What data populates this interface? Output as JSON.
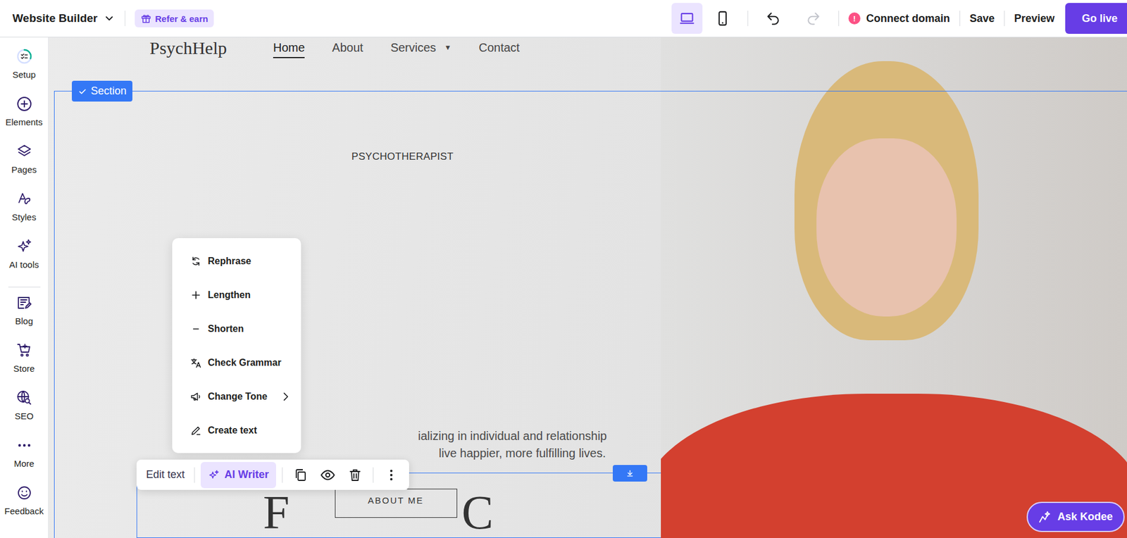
{
  "topbar": {
    "app_menu": "Website Builder",
    "refer": "Refer & earn",
    "devices": [
      {
        "kind": "desktop",
        "selected": true
      },
      {
        "kind": "mobile",
        "selected": false
      }
    ],
    "history": [
      {
        "kind": "undo",
        "disabled": false
      },
      {
        "kind": "redo",
        "disabled": true
      }
    ],
    "domain": {
      "badge": "!",
      "label": "Connect domain"
    },
    "actions": [
      "Save",
      "Preview"
    ],
    "go_live": "Go live"
  },
  "sidebar": {
    "top_items": [
      {
        "label": "Setup",
        "kind": "setup"
      },
      {
        "label": "Elements",
        "kind": "elements"
      },
      {
        "label": "Pages",
        "kind": "pages"
      },
      {
        "label": "Styles",
        "kind": "styles"
      },
      {
        "label": "AI tools",
        "kind": "ai"
      }
    ],
    "bottom_items": [
      {
        "label": "Blog",
        "kind": "blog"
      },
      {
        "label": "Store",
        "kind": "store"
      },
      {
        "label": "SEO",
        "kind": "seo"
      },
      {
        "label": "More",
        "kind": "more"
      },
      {
        "label": "Feedback",
        "kind": "feedback"
      }
    ]
  },
  "site": {
    "logo": "PsychHelp",
    "nav": [
      {
        "label": "Home",
        "selected": true,
        "dropdown": ""
      },
      {
        "label": "About",
        "selected": false,
        "dropdown": ""
      },
      {
        "label": "Services",
        "selected": false,
        "dropdown": "▼"
      },
      {
        "label": "Contact",
        "selected": false,
        "dropdown": ""
      }
    ],
    "section_badge": "Section",
    "eyebrow": "PSYCHOTHERAPIST",
    "intro_lines": [
      "ializing in individual and relationship",
      "live happier, more fulfilling lives."
    ],
    "decor_letters": [
      "F",
      "C"
    ],
    "button": "ABOUT ME"
  },
  "toolbar": {
    "items": [
      {
        "kind": "text",
        "label": "Edit text",
        "selected": false
      },
      {
        "kind": "ai",
        "label": "AI Writer",
        "selected": true
      },
      {
        "kind": "copy",
        "label": "",
        "selected": false
      },
      {
        "kind": "eye",
        "label": "",
        "selected": false
      },
      {
        "kind": "trash",
        "label": "",
        "selected": false
      },
      {
        "kind": "more",
        "label": "",
        "selected": false
      }
    ]
  },
  "ai_menu": {
    "items": [
      {
        "label": "Rephrase",
        "kind": "rephrase",
        "submenu": false
      },
      {
        "label": "Lengthen",
        "kind": "lengthen",
        "submenu": false
      },
      {
        "label": "Shorten",
        "kind": "shorten",
        "submenu": false
      },
      {
        "label": "Check Grammar",
        "kind": "grammar",
        "submenu": false
      },
      {
        "label": "Change Tone",
        "kind": "tone",
        "submenu": true
      },
      {
        "label": "Create text",
        "kind": "create",
        "submenu": false
      }
    ]
  },
  "assistant": {
    "label": "Ask Kodee"
  }
}
